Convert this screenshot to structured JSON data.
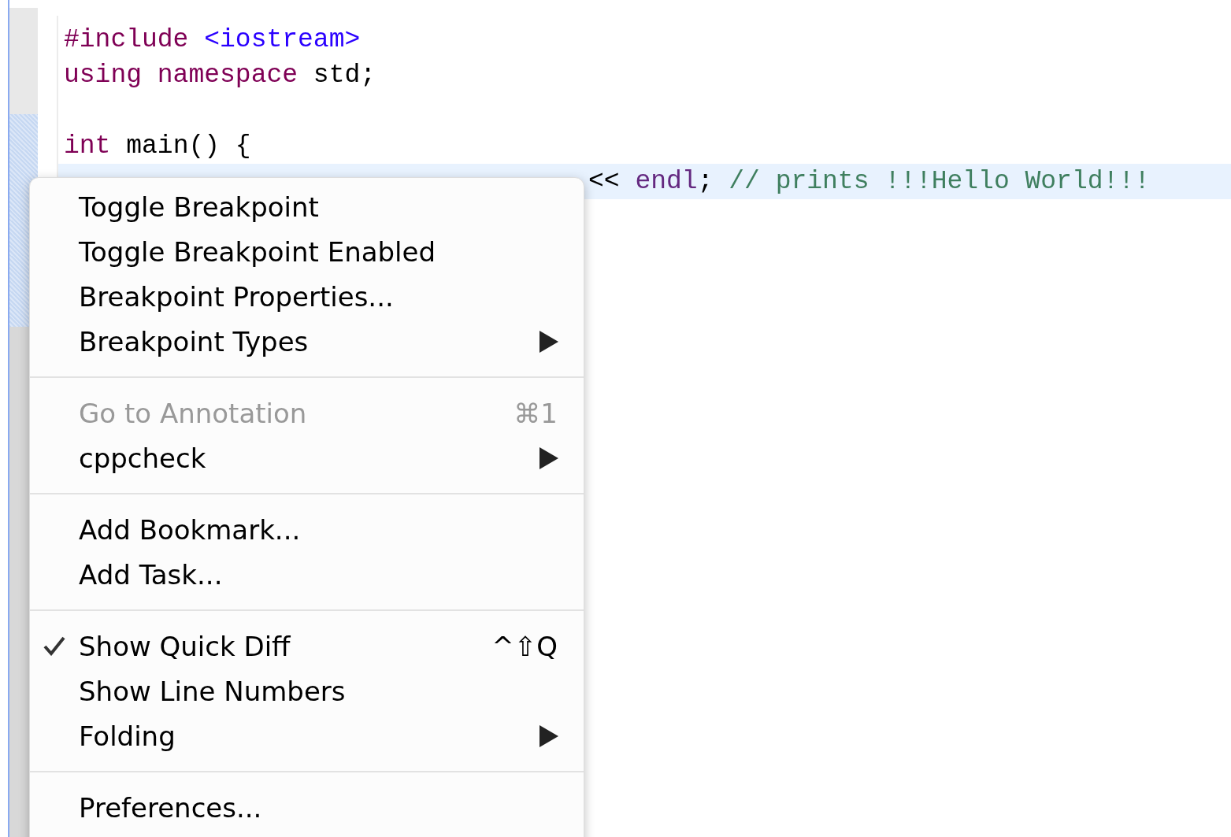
{
  "editor": {
    "lines": [
      {
        "kind": "code",
        "tokens": [
          {
            "kind": "preprocessor",
            "text": "#include"
          },
          {
            "kind": "string",
            "text": " <iostream>"
          }
        ]
      },
      {
        "kind": "code",
        "tokens": [
          {
            "kind": "keyword",
            "text": "using namespace"
          },
          {
            "kind": "plain",
            "text": " std;"
          }
        ]
      },
      {
        "kind": "blank"
      },
      {
        "kind": "code",
        "tokens": [
          {
            "kind": "keyword",
            "text": "int"
          },
          {
            "kind": "plain",
            "text": " main() {"
          }
        ]
      },
      {
        "kind": "covered",
        "highlighted": true,
        "tokens": [
          {
            "kind": "plain",
            "text": "<< "
          },
          {
            "kind": "builtin",
            "text": "endl"
          },
          {
            "kind": "plain",
            "text": "; "
          },
          {
            "kind": "comment",
            "text": "// prints !!!Hello World!!!"
          }
        ]
      }
    ]
  },
  "context_menu": {
    "items": [
      {
        "kind": "item",
        "label": "Toggle Breakpoint",
        "disabled": false,
        "checked": false
      },
      {
        "kind": "item",
        "label": "Toggle Breakpoint Enabled",
        "disabled": false,
        "checked": false
      },
      {
        "kind": "item",
        "label": "Breakpoint Properties...",
        "disabled": false,
        "checked": false
      },
      {
        "kind": "item",
        "label": "Breakpoint Types",
        "disabled": false,
        "checked": false,
        "submenu": true
      },
      {
        "kind": "separator"
      },
      {
        "kind": "item",
        "label": "Go to Annotation",
        "shortcut": "⌘1",
        "disabled": true,
        "checked": false
      },
      {
        "kind": "item",
        "label": "cppcheck",
        "disabled": false,
        "checked": false,
        "submenu": true
      },
      {
        "kind": "separator"
      },
      {
        "kind": "item",
        "label": "Add Bookmark...",
        "disabled": false,
        "checked": false
      },
      {
        "kind": "item",
        "label": "Add Task...",
        "disabled": false,
        "checked": false
      },
      {
        "kind": "separator"
      },
      {
        "kind": "item",
        "label": "Show Quick Diff",
        "shortcut": "^⇧Q",
        "disabled": false,
        "checked": true
      },
      {
        "kind": "item",
        "label": "Show Line Numbers",
        "disabled": false,
        "checked": false
      },
      {
        "kind": "item",
        "label": "Folding",
        "disabled": false,
        "checked": false,
        "submenu": true
      },
      {
        "kind": "separator"
      },
      {
        "kind": "item",
        "label": "Preferences...",
        "disabled": false,
        "checked": false
      }
    ]
  }
}
